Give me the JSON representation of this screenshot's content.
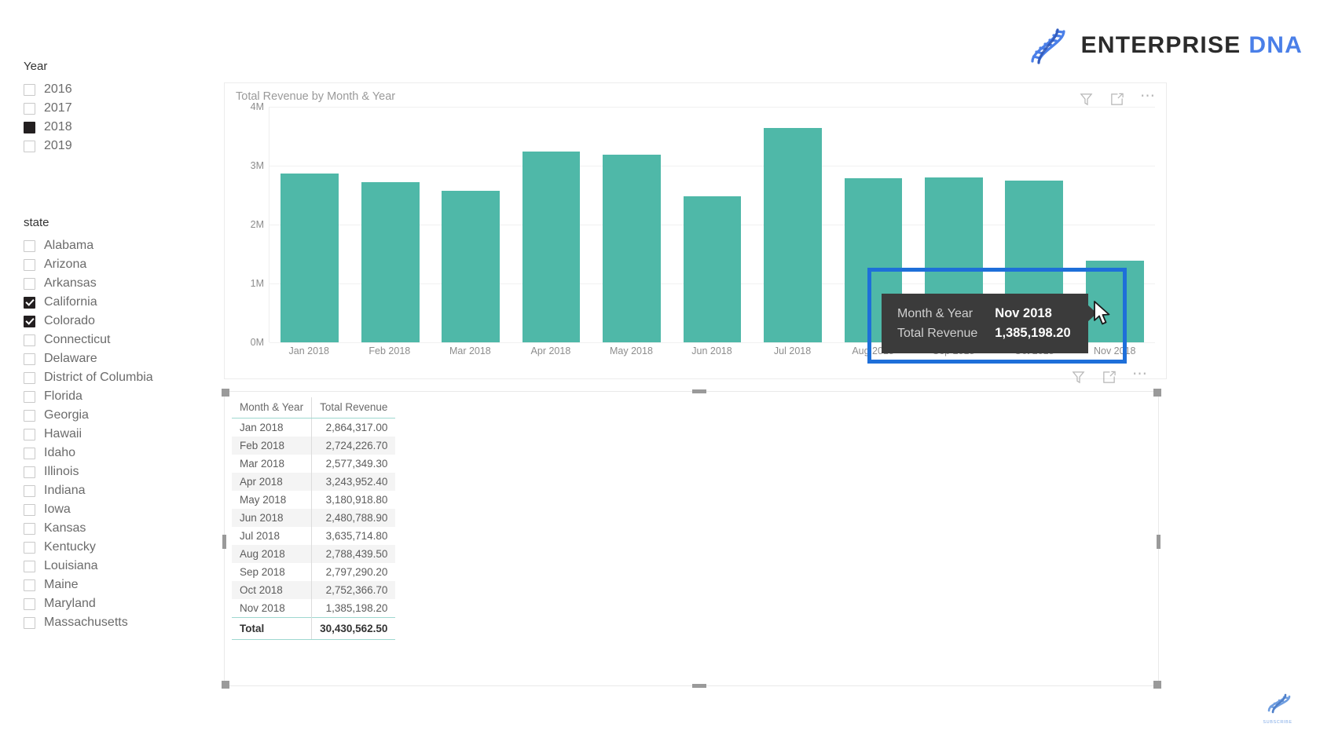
{
  "brand": {
    "name_primary": "ENTERPRISE",
    "name_secondary": "DNA",
    "logo_icon": "dna-helix-icon",
    "accent_color": "#4a7fe8"
  },
  "slicers": [
    {
      "id": "year",
      "title": "Year",
      "items": [
        {
          "label": "2016",
          "checked": false,
          "tick": false
        },
        {
          "label": "2017",
          "checked": false,
          "tick": false
        },
        {
          "label": "2018",
          "checked": true,
          "tick": false
        },
        {
          "label": "2019",
          "checked": false,
          "tick": false
        }
      ]
    },
    {
      "id": "state",
      "title": "state",
      "items": [
        {
          "label": "Alabama",
          "checked": false,
          "tick": false
        },
        {
          "label": "Arizona",
          "checked": false,
          "tick": false
        },
        {
          "label": "Arkansas",
          "checked": false,
          "tick": false
        },
        {
          "label": "California",
          "checked": true,
          "tick": true
        },
        {
          "label": "Colorado",
          "checked": true,
          "tick": true
        },
        {
          "label": "Connecticut",
          "checked": false,
          "tick": false
        },
        {
          "label": "Delaware",
          "checked": false,
          "tick": false
        },
        {
          "label": "District of Columbia",
          "checked": false,
          "tick": false
        },
        {
          "label": "Florida",
          "checked": false,
          "tick": false
        },
        {
          "label": "Georgia",
          "checked": false,
          "tick": false
        },
        {
          "label": "Hawaii",
          "checked": false,
          "tick": false
        },
        {
          "label": "Idaho",
          "checked": false,
          "tick": false
        },
        {
          "label": "Illinois",
          "checked": false,
          "tick": false
        },
        {
          "label": "Indiana",
          "checked": false,
          "tick": false
        },
        {
          "label": "Iowa",
          "checked": false,
          "tick": false
        },
        {
          "label": "Kansas",
          "checked": false,
          "tick": false
        },
        {
          "label": "Kentucky",
          "checked": false,
          "tick": false
        },
        {
          "label": "Louisiana",
          "checked": false,
          "tick": false
        },
        {
          "label": "Maine",
          "checked": false,
          "tick": false
        },
        {
          "label": "Maryland",
          "checked": false,
          "tick": false
        },
        {
          "label": "Massachusetts",
          "checked": false,
          "tick": false
        }
      ]
    }
  ],
  "chart_visual": {
    "title": "Total Revenue by Month & Year",
    "icons": [
      "filter-icon",
      "focus-mode-icon",
      "more-options-icon"
    ]
  },
  "chart_data": {
    "type": "bar",
    "title": "Total Revenue by Month & Year",
    "xlabel": "",
    "ylabel": "",
    "categories": [
      "Jan 2018",
      "Feb 2018",
      "Mar 2018",
      "Apr 2018",
      "May 2018",
      "Jun 2018",
      "Jul 2018",
      "Aug 2018",
      "Sep 2018",
      "Oct 2018",
      "Nov 2018"
    ],
    "values": [
      2864317.0,
      2724226.7,
      2577349.3,
      3243952.4,
      3180918.8,
      2480788.9,
      3635714.8,
      2788439.5,
      2797290.2,
      2752366.7,
      1385198.2
    ],
    "ylim": [
      0,
      4000000
    ],
    "ytick_labels": [
      "0M",
      "1M",
      "2M",
      "3M",
      "4M"
    ],
    "ytick_values": [
      0,
      1000000,
      2000000,
      3000000,
      4000000
    ],
    "bar_color": "#4fb8a8",
    "grid": true,
    "legend": "none"
  },
  "table_visual": {
    "icons": [
      "filter-icon",
      "focus-mode-icon",
      "more-options-icon"
    ],
    "columns": [
      "Month & Year",
      "Total Revenue"
    ],
    "rows": [
      {
        "month": "Jan 2018",
        "revenue": "2,864,317.00"
      },
      {
        "month": "Feb 2018",
        "revenue": "2,724,226.70"
      },
      {
        "month": "Mar 2018",
        "revenue": "2,577,349.30"
      },
      {
        "month": "Apr 2018",
        "revenue": "3,243,952.40"
      },
      {
        "month": "May 2018",
        "revenue": "3,180,918.80"
      },
      {
        "month": "Jun 2018",
        "revenue": "2,480,788.90"
      },
      {
        "month": "Jul 2018",
        "revenue": "3,635,714.80"
      },
      {
        "month": "Aug 2018",
        "revenue": "2,788,439.50"
      },
      {
        "month": "Sep 2018",
        "revenue": "2,797,290.20"
      },
      {
        "month": "Oct 2018",
        "revenue": "2,752,366.70"
      },
      {
        "month": "Nov 2018",
        "revenue": "1,385,198.20"
      }
    ],
    "total_label": "Total",
    "total_value": "30,430,562.50"
  },
  "tooltip": {
    "key1": "Month & Year",
    "val1": "Nov 2018",
    "key2": "Total Revenue",
    "val2": "1,385,198.20",
    "background": "#3b3b3b"
  },
  "highlight": {
    "color": "#1e6fd9"
  },
  "subscribe": {
    "label": "SUBSCRIBE",
    "icon": "dna-helix-icon"
  }
}
